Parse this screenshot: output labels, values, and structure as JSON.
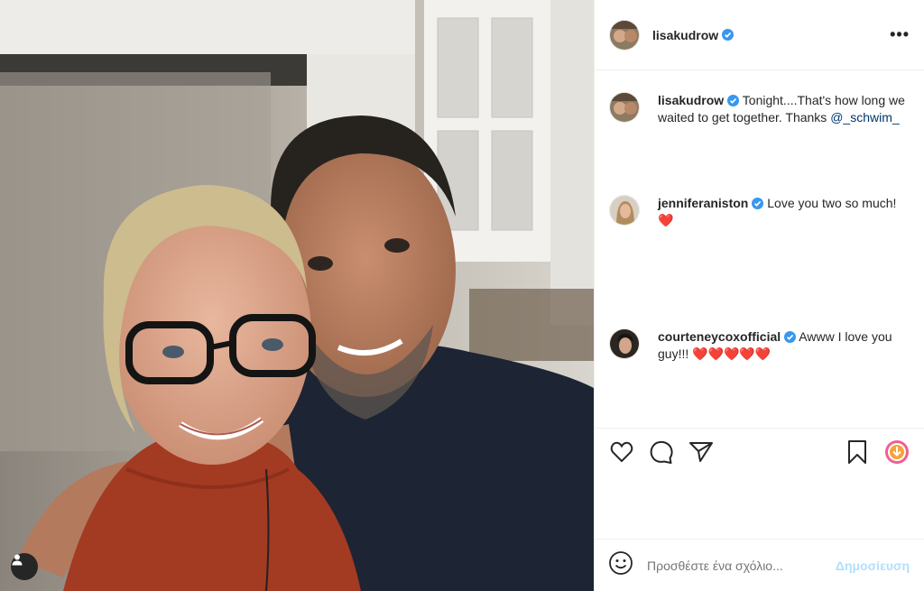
{
  "post": {
    "username": "lisakudrow",
    "more_label": "•••"
  },
  "caption": {
    "username": "lisakudrow",
    "text": "Tonight....That's how long we waited to get together. Thanks ",
    "mention": "@_schwim_"
  },
  "comments": [
    {
      "username": "jenniferaniston",
      "text": "Love you two so much!",
      "emoji": "❤️"
    },
    {
      "username": "courteneycoxofficial",
      "text": "Awww I love you guy!!!",
      "emoji": "❤️❤️❤️❤️❤️"
    }
  ],
  "add_comment": {
    "placeholder": "Προσθέστε ένα σχόλιο...",
    "post_label": "Δημοσίευση"
  },
  "colors": {
    "verified": "#3897f0",
    "heart": "#d4161d",
    "post_button": "#b2dffc"
  }
}
